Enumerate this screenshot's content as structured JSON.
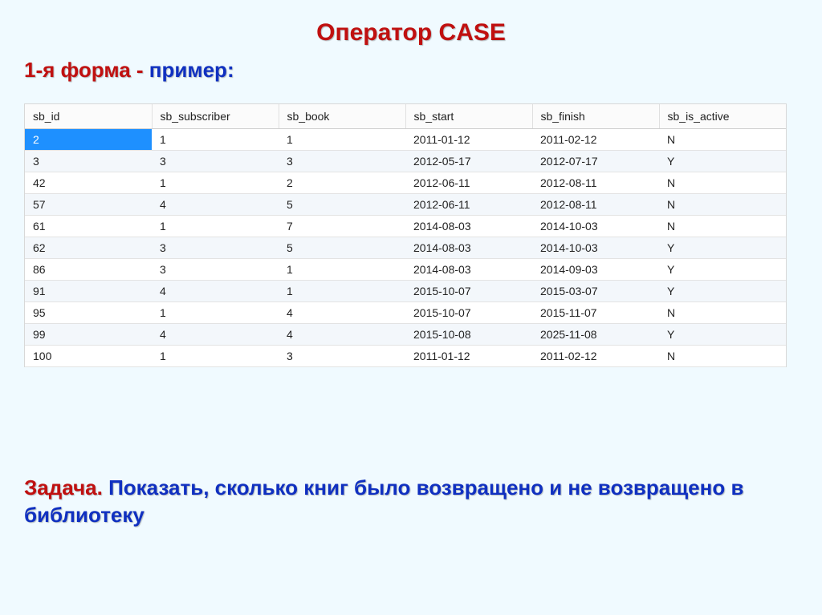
{
  "title": "Оператор CASE",
  "subtitle": {
    "part_a": "1-я форма - ",
    "part_b": "пример:"
  },
  "table": {
    "columns": [
      "sb_id",
      "sb_subscriber",
      "sb_book",
      "sb_start",
      "sb_finish",
      "sb_is_active"
    ],
    "rows": [
      [
        "2",
        "1",
        "1",
        "2011-01-12",
        "2011-02-12",
        "N"
      ],
      [
        "3",
        "3",
        "3",
        "2012-05-17",
        "2012-07-17",
        "Y"
      ],
      [
        "42",
        "1",
        "2",
        "2012-06-11",
        "2012-08-11",
        "N"
      ],
      [
        "57",
        "4",
        "5",
        "2012-06-11",
        "2012-08-11",
        "N"
      ],
      [
        "61",
        "1",
        "7",
        "2014-08-03",
        "2014-10-03",
        "N"
      ],
      [
        "62",
        "3",
        "5",
        "2014-08-03",
        "2014-10-03",
        "Y"
      ],
      [
        "86",
        "3",
        "1",
        "2014-08-03",
        "2014-09-03",
        "Y"
      ],
      [
        "91",
        "4",
        "1",
        "2015-10-07",
        "2015-03-07",
        "Y"
      ],
      [
        "95",
        "1",
        "4",
        "2015-10-07",
        "2015-11-07",
        "N"
      ],
      [
        "99",
        "4",
        "4",
        "2015-10-08",
        "2025-11-08",
        "Y"
      ],
      [
        "100",
        "1",
        "3",
        "2011-01-12",
        "2011-02-12",
        "N"
      ]
    ]
  },
  "task": {
    "label": "Задача. ",
    "body": "Показать, сколько книг было возвращено и не возвращено в библиотеку"
  }
}
